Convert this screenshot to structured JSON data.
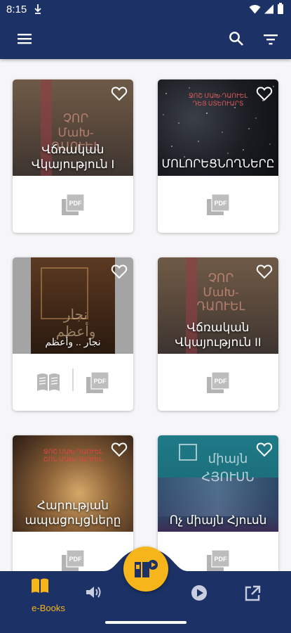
{
  "status_bar": {
    "time": "8:15"
  },
  "colors": {
    "primary": "#1c3266",
    "accent": "#f5b51b",
    "background": "#f6f6f8"
  },
  "app_bar": {
    "icons": [
      "menu-icon",
      "search-icon",
      "filter-icon"
    ]
  },
  "books": [
    {
      "title": "Վճռական\nՎկայություն I",
      "cover_deco": "ՉՈՐ\nՄաԽ-ԴԱՈՒԵԼ",
      "formats": [
        "pdf"
      ],
      "favorite": false
    },
    {
      "title": "ՄՈԼՈՐԵՑՆՈՂՆԵՐԸ",
      "cover_deco": "ՋՈՇ ՄԱԽ-ԴԱՈՒԵԼ\nԴԵՅ ՍՏԵՈՒԱՐՏ",
      "formats": [
        "pdf"
      ],
      "favorite": false
    },
    {
      "title": "نجار .. وأعظم",
      "cover_deco": "نجار\nوأعظم",
      "formats": [
        "ebook",
        "pdf"
      ],
      "favorite": false
    },
    {
      "title": "Վճռական\nՎկայություն II",
      "cover_deco": "ՉՈՐ\nՄաԽ-ԴԱՈՒԵԼ",
      "formats": [
        "pdf"
      ],
      "favorite": false
    },
    {
      "title": "Հարության\nապացույցները",
      "cover_deco": "ՋՈՇ ՄԱԽ-ԴԱՈՒԵԼ\nՇՈՆ ՄԱԽ-ԴԱՈՒԵԼ",
      "formats": [
        "pdf"
      ],
      "favorite": false
    },
    {
      "title": "Ոչ միայն Հյուսն",
      "cover_deco": "միայն\nՀՅՈՒՍՆ",
      "formats": [
        "pdf"
      ],
      "favorite": false
    }
  ],
  "bottom_nav": {
    "items": [
      {
        "label": "e-Books",
        "icon": "book-icon",
        "active": true
      },
      {
        "label": "",
        "icon": "speaker-icon",
        "active": false
      },
      {
        "label": "",
        "icon": "play-icon",
        "active": false
      },
      {
        "label": "",
        "icon": "external-link-icon",
        "active": false
      }
    ],
    "fab_icon": "audiobook-icon"
  }
}
